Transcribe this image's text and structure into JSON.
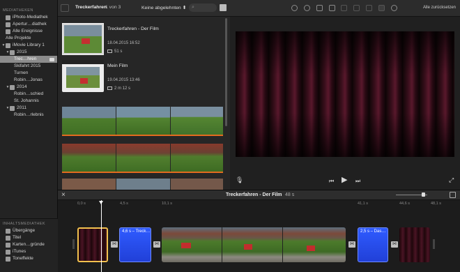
{
  "libraries": {
    "header": "MEDIATHEKEN",
    "items": [
      {
        "label": "iPhoto-Mediathek",
        "icon": "iphoto-icon",
        "level": 0,
        "tri": ""
      },
      {
        "label": "Apertur…diathek",
        "icon": "aperture-icon",
        "level": 0,
        "tri": ""
      },
      {
        "label": "Alle Ereignisse",
        "icon": "star-icon",
        "level": 0,
        "tri": ""
      },
      {
        "label": "Alle Projekte",
        "icon": "",
        "level": 0,
        "tri": ""
      },
      {
        "label": "iMovie Library 1",
        "icon": "library-icon",
        "level": 0,
        "tri": "▼"
      },
      {
        "label": "2015",
        "icon": "folder-icon",
        "level": 1,
        "tri": "▼"
      },
      {
        "label": "Trec…hren",
        "icon": "",
        "level": 2,
        "tri": "",
        "selected": true
      },
      {
        "label": "Skifahrt 2015",
        "icon": "",
        "level": 2,
        "tri": ""
      },
      {
        "label": "Turnen",
        "icon": "",
        "level": 2,
        "tri": ""
      },
      {
        "label": "Robin…Jonas",
        "icon": "",
        "level": 2,
        "tri": ""
      },
      {
        "label": "2014",
        "icon": "folder-icon",
        "level": 1,
        "tri": "▼"
      },
      {
        "label": "Robin…schied",
        "icon": "",
        "level": 2,
        "tri": ""
      },
      {
        "label": "St. Johannis",
        "icon": "",
        "level": 2,
        "tri": ""
      },
      {
        "label": "2011",
        "icon": "folder-icon",
        "level": 1,
        "tri": "▼"
      },
      {
        "label": "Robin…rlebnis",
        "icon": "",
        "level": 2,
        "tri": ""
      }
    ]
  },
  "content_library": {
    "header": "INHALTSMEDIATHEK",
    "items": [
      {
        "label": "Übergänge",
        "icon": "transitions-icon"
      },
      {
        "label": "Titel",
        "icon": "titles-icon"
      },
      {
        "label": "Karten…gründe",
        "icon": "maps-icon"
      },
      {
        "label": "iTunes",
        "icon": "itunes-icon"
      },
      {
        "label": "Toneffekte",
        "icon": "sound-effects-icon"
      }
    ]
  },
  "browser": {
    "event_title": "Treckerfahren",
    "count": "1 von 3",
    "filter": "Keine abgelehnten",
    "projects": [
      {
        "name": "Treckerfahren - Der Film",
        "date": "18.04.2015 16:52",
        "duration": "51 s"
      },
      {
        "name": "Mein Film",
        "date": "19.04.2015 13:46",
        "duration": "2 m 12 s"
      }
    ]
  },
  "viewer": {
    "reset_label": "Alle zurücksetzen"
  },
  "timeline": {
    "title": "Treckerfahren - Der Film",
    "duration": "48 s",
    "ticks": [
      "0,0 s",
      "4,5 s",
      "10,1 s",
      "41,1 s",
      "44,6 s",
      "48,1 s"
    ],
    "title_clips": [
      "4,6 s – Treck…",
      "2,5 s – Das…"
    ]
  },
  "colors": {
    "accent_orange": "#e36b1f",
    "title_clip_blue": "#2f5bff",
    "selection_yellow": "#f2c14e"
  }
}
